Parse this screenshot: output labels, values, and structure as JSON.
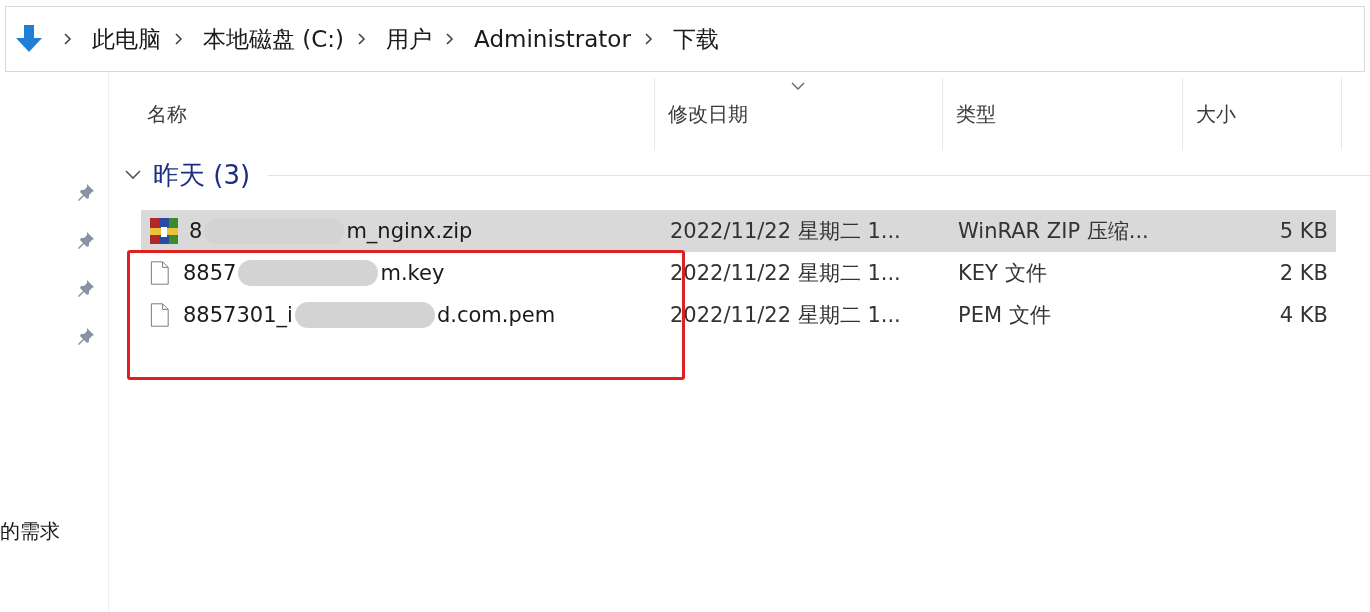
{
  "address_bar": {
    "crumbs": [
      "此电脑",
      "本地磁盘 (C:)",
      "用户",
      "Administrator",
      "下载"
    ]
  },
  "nav_pane": {
    "pinned_count_text": "的需求"
  },
  "columns": [
    {
      "label": "名称",
      "sorted": false
    },
    {
      "label": "修改日期",
      "sorted": true
    },
    {
      "label": "类型",
      "sorted": false
    },
    {
      "label": "大小",
      "sorted": false
    }
  ],
  "group": {
    "label": "昨天 (3)",
    "expanded": true
  },
  "files": [
    {
      "kind": "archive",
      "name_start": "8",
      "name_end": "m_nginx.zip",
      "date": "2022/11/22 星期二 1...",
      "type": "WinRAR ZIP 压缩...",
      "size": "5 KB",
      "selected": true
    },
    {
      "kind": "file",
      "name_start": "8857",
      "name_end": "m.key",
      "date": "2022/11/22 星期二 1...",
      "type": "KEY 文件",
      "size": "2 KB",
      "selected": false
    },
    {
      "kind": "file",
      "name_start": "8857301_i",
      "name_end": "d.com.pem",
      "date": "2022/11/22 星期二 1...",
      "type": "PEM 文件",
      "size": "4 KB",
      "selected": false
    }
  ]
}
